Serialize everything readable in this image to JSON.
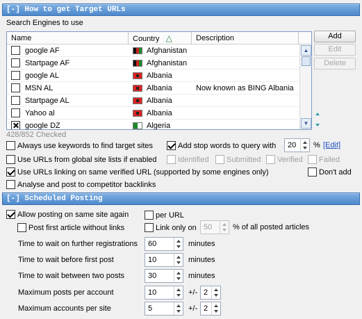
{
  "section1": {
    "title": "[-] How to get Target URLs",
    "search_engines_label": "Search Engines to use",
    "columns": [
      "Name",
      "Country",
      "Description"
    ],
    "sort_indicator": "△",
    "rows": [
      {
        "name": "google AF",
        "country": "Afghanistan",
        "flag": "af",
        "description": "",
        "checked": false
      },
      {
        "name": "Startpage AF",
        "country": "Afghanistan",
        "flag": "af",
        "description": "",
        "checked": false
      },
      {
        "name": "google AL",
        "country": "Albania",
        "flag": "al",
        "description": "",
        "checked": false
      },
      {
        "name": "MSN AL",
        "country": "Albania",
        "flag": "al",
        "description": "Now known as BING Albania",
        "checked": false
      },
      {
        "name": "Startpage AL",
        "country": "Albania",
        "flag": "al",
        "description": "",
        "checked": false
      },
      {
        "name": "Yahoo al",
        "country": "Albania",
        "flag": "al",
        "description": "",
        "checked": false
      },
      {
        "name": "google DZ",
        "country": "Algeria",
        "flag": "dz",
        "description": "",
        "checked": true
      }
    ],
    "buttons": {
      "add": "Add",
      "edit": "Edit",
      "delete": "Delete"
    },
    "checked_count": "428/852 Checked",
    "always_keywords": "Always use keywords to find target sites",
    "add_stop_words": "Add stop words to query with",
    "stop_words_value": "20",
    "percent": "%",
    "edit_link": "[Edit]",
    "use_global_lists": "Use URLs from global site lists if enabled",
    "global_identified": "Identified",
    "global_submitted": "Submitted",
    "global_verified": "Verified",
    "global_failed": "Failed",
    "use_urls_linking": "Use URLs linking on same verified URL (supported by some engines only)",
    "dont_add": "Don't add",
    "analyse_competitor": "Analyse and post to competitor backlinks"
  },
  "section2": {
    "title": "[-] Scheduled Posting",
    "allow_same_site": "Allow posting on same site again",
    "per_url": "per URL",
    "post_first_article": "Post first article without links",
    "link_only_on": "Link only on",
    "link_only_value": "50",
    "of_all_posted": "% of all posted articles",
    "fields": [
      {
        "label": "Time to wait on further registrations",
        "value": "60",
        "unit": "minutes"
      },
      {
        "label": "Time to wait before first post",
        "value": "10",
        "unit": "minutes"
      },
      {
        "label": "Time to wait between two posts",
        "value": "30",
        "unit": "minutes"
      },
      {
        "label": "Maximum posts per account",
        "value": "10",
        "unit": "+/-",
        "plusminus": "2"
      },
      {
        "label": "Maximum accounts per site",
        "value": "5",
        "unit": "+/-",
        "plusminus": "2"
      }
    ]
  }
}
